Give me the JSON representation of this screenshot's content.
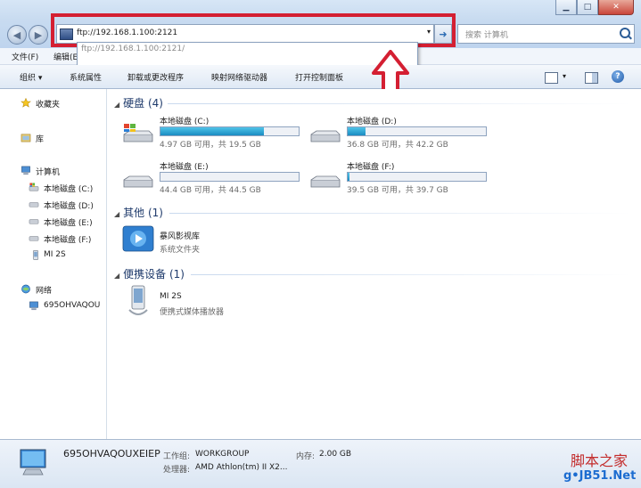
{
  "window": {
    "minimize_glyph": "▁",
    "maximize_glyph": "□",
    "close_glyph": "✕",
    "back_glyph": "◀",
    "forward_glyph": "▶"
  },
  "address": {
    "value": "ftp://192.168.1.100:2121",
    "dropdown_glyph": "▾",
    "go_glyph": "➜",
    "suggestion": "ftp://192.168.1.100:2121/"
  },
  "search": {
    "placeholder": "搜索 计算机"
  },
  "menu": [
    "文件(F)",
    "编辑(E)"
  ],
  "toolbar": {
    "items": [
      "组织 ▾",
      "系统属性",
      "卸载或更改程序",
      "映射网络驱动器",
      "打开控制面板"
    ],
    "view_caret": "▾",
    "help": "?"
  },
  "sidebar": {
    "favorites": "收藏夹",
    "libraries": "库",
    "computer": "计算机",
    "drives": [
      "本地磁盘 (C:)",
      "本地磁盘 (D:)",
      "本地磁盘 (E:)",
      "本地磁盘 (F:)"
    ],
    "device": "MI 2S",
    "network": "网络",
    "network_pc": "695OHVAQOU"
  },
  "groups": {
    "disks": "硬盘 (4)",
    "other": "其他 (1)",
    "portable": "便携设备 (1)"
  },
  "drives": [
    {
      "name": "本地磁盘 (C:)",
      "detail": "4.97 GB 可用，共 19.5 GB",
      "used_fraction": 0.75
    },
    {
      "name": "本地磁盘 (D:)",
      "detail": "36.8 GB 可用，共 42.2 GB",
      "used_fraction": 0.13
    },
    {
      "name": "本地磁盘 (E:)",
      "detail": "44.4 GB 可用，共 44.5 GB",
      "used_fraction": 0.0
    },
    {
      "name": "本地磁盘 (F:)",
      "detail": "39.5 GB 可用，共 39.7 GB",
      "used_fraction": 0.01
    }
  ],
  "other_item": {
    "name": "暴风影视库",
    "type": "系统文件夹"
  },
  "portable_item": {
    "name": "MI 2S",
    "type": "便携式媒体播放器"
  },
  "status": {
    "computer_name": "695OHVAQOUXEIEP",
    "workgroup_label": "工作组:",
    "workgroup": "WORKGROUP",
    "memory_label": "内存:",
    "memory": "2.00 GB",
    "cpu_label": "处理器:",
    "cpu": "AMD Athlon(tm) II X2..."
  },
  "watermark": {
    "line1": "脚本之家",
    "line2": "g•JB51.Net"
  },
  "colors": {
    "highlight": "#d41f32",
    "drive_fill": "#1a8cc2"
  }
}
